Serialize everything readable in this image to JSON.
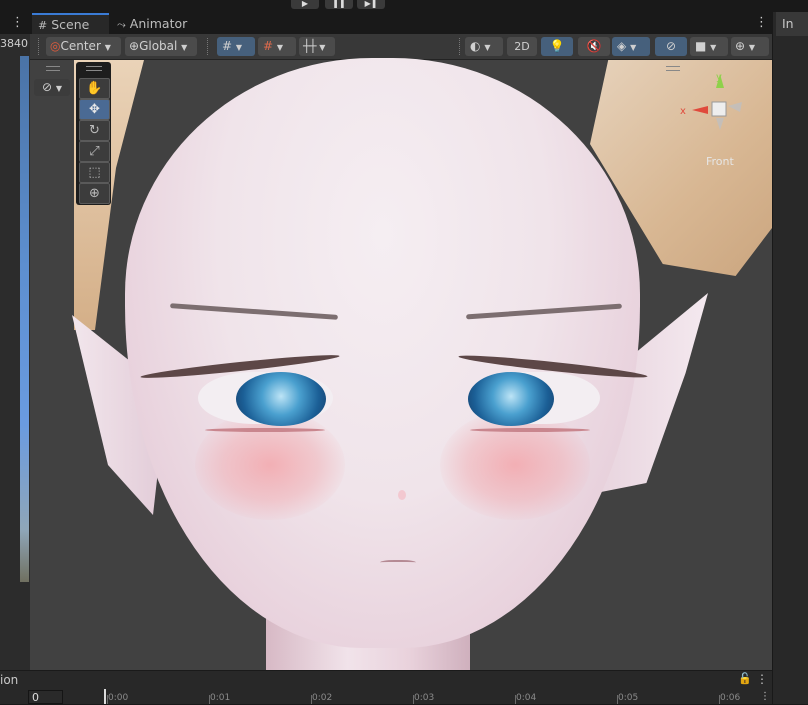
{
  "playbar": {
    "play_icon": "play-icon",
    "pause_icon": "pause-icon",
    "step_icon": "step-icon"
  },
  "tabs": [
    {
      "label": "Scene",
      "icon": "grid-icon",
      "active": true
    },
    {
      "label": "Animator",
      "icon": "animator-icon",
      "active": false
    }
  ],
  "left_panel": {
    "number": "3840"
  },
  "toolbar": {
    "pivot_label": "Center",
    "space_label": "Global",
    "mode_2d_label": "2D"
  },
  "gizmo": {
    "axis_y": "y",
    "axis_x": "x",
    "view_label": "Front"
  },
  "right_panel": {
    "tab_label": "In"
  },
  "bottom": {
    "tab_label": "ion",
    "frame_value": "0",
    "ticks": [
      "0:00",
      "0:01",
      "0:02",
      "0:03",
      "0:04",
      "0:05",
      "0:06"
    ]
  },
  "colors": {
    "accent": "#3a7bd5",
    "selected_tool": "#4a6a94",
    "viewport_bg": "#414141"
  }
}
